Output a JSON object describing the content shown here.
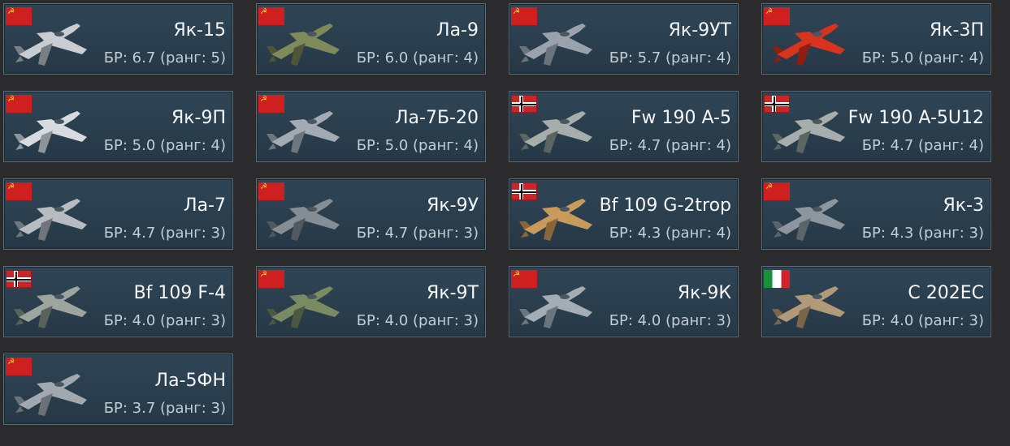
{
  "cards": [
    {
      "name": "Як-15",
      "br": "БР: 6.7 (ранг: 5)",
      "nation": "ussr",
      "plane_color": "#c9ccd0",
      "plane_accent": "#7b7f84"
    },
    {
      "name": "Ла-9",
      "br": "БР: 6.0 (ранг: 4)",
      "nation": "ussr",
      "plane_color": "#7f8a5a",
      "plane_accent": "#4f5638"
    },
    {
      "name": "Як-9УТ",
      "br": "БР: 5.7 (ранг: 4)",
      "nation": "ussr",
      "plane_color": "#9aa3ad",
      "plane_accent": "#6b737c"
    },
    {
      "name": "Як-3П",
      "br": "БР: 5.0 (ранг: 4)",
      "nation": "ussr",
      "plane_color": "#d8331f",
      "plane_accent": "#8e1d12"
    },
    {
      "name": "Як-9П",
      "br": "БР: 5.0 (ранг: 4)",
      "nation": "ussr",
      "plane_color": "#d7dbe0",
      "plane_accent": "#8e949a"
    },
    {
      "name": "Ла-7Б-20",
      "br": "БР: 5.0 (ранг: 4)",
      "nation": "ussr",
      "plane_color": "#a3aab3",
      "plane_accent": "#6e757d"
    },
    {
      "name": "Fw 190 A-5",
      "br": "БР: 4.7 (ранг: 4)",
      "nation": "germany",
      "plane_color": "#a7adaa",
      "plane_accent": "#5c6561"
    },
    {
      "name": "Fw 190 A-5U12",
      "br": "БР: 4.7 (ранг: 4)",
      "nation": "germany",
      "plane_color": "#a7adaa",
      "plane_accent": "#5c6561"
    },
    {
      "name": "Ла-7",
      "br": "БР: 4.7 (ранг: 3)",
      "nation": "ussr",
      "plane_color": "#b7bcc2",
      "plane_accent": "#6f757b"
    },
    {
      "name": "Як-9У",
      "br": "БР: 4.7 (ранг: 3)",
      "nation": "ussr",
      "plane_color": "#858d95",
      "plane_accent": "#51585f"
    },
    {
      "name": "Bf 109 G-2trop",
      "br": "БР: 4.3 (ранг: 4)",
      "nation": "germany",
      "plane_color": "#c89a5c",
      "plane_accent": "#8a6638"
    },
    {
      "name": "Як-3",
      "br": "БР: 4.3 (ранг: 3)",
      "nation": "ussr",
      "plane_color": "#8d969e",
      "plane_accent": "#5c646b"
    },
    {
      "name": "Bf 109 F-4",
      "br": "БР: 4.0 (ранг: 3)",
      "nation": "germany",
      "plane_color": "#9ea59f",
      "plane_accent": "#5b625c"
    },
    {
      "name": "Як-9Т",
      "br": "БР: 4.0 (ранг: 3)",
      "nation": "ussr",
      "plane_color": "#7a8a62",
      "plane_accent": "#4c5840"
    },
    {
      "name": "Як-9К",
      "br": "БР: 4.0 (ранг: 3)",
      "nation": "ussr",
      "plane_color": "#a4adb6",
      "plane_accent": "#6c747c"
    },
    {
      "name": "C 202EC",
      "br": "БР: 4.0 (ранг: 3)",
      "nation": "italy",
      "plane_color": "#b09a7a",
      "plane_accent": "#7a654a"
    },
    {
      "name": "Ла-5ФН",
      "br": "БР: 3.7 (ранг: 3)",
      "nation": "ussr",
      "plane_color": "#a1a8b0",
      "plane_accent": "#6a7178"
    }
  ]
}
